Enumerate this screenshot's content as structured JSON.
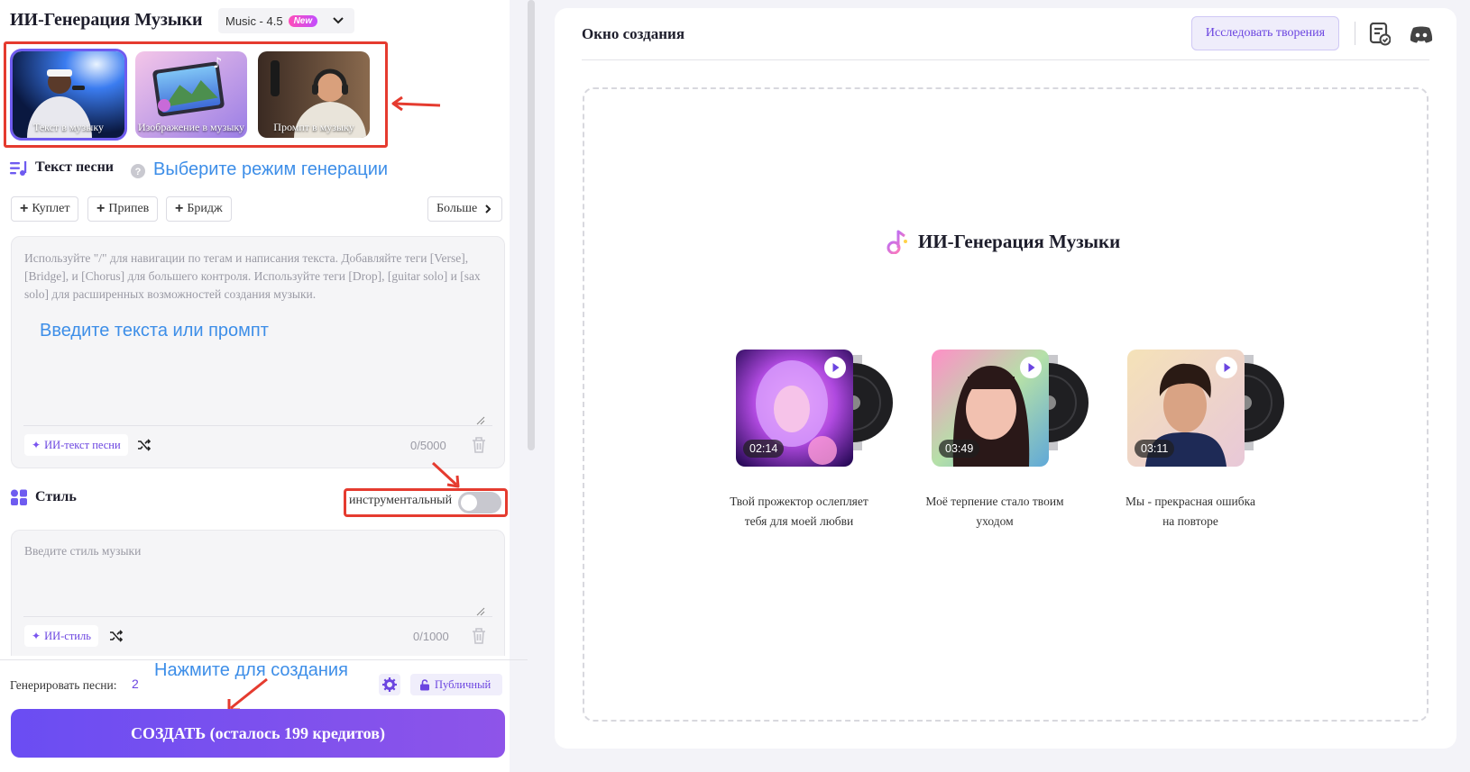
{
  "header": {
    "title": "ИИ-Генерация Музыки",
    "model_label": "Music - 4.5",
    "model_badge": "New"
  },
  "modes": [
    {
      "label": "Текст в музыку",
      "active": true
    },
    {
      "label": "Изображение в музыку",
      "active": false
    },
    {
      "label": "Промпт в музыку",
      "active": false
    }
  ],
  "annotations": {
    "mode_hint": "Выберите режим генерации",
    "lyrics_hint": "Введите текста или промпт",
    "create_hint": "Нажмите для создания"
  },
  "lyrics": {
    "title": "Текст песни",
    "tags": [
      "Куплет",
      "Припев",
      "Бридж"
    ],
    "more_label": "Больше",
    "placeholder": "Используйте \"/\" для навигации по тегам и написания текста. Добавляйте теги [Verse], [Bridge], и [Chorus] для большего контроля. Используйте теги [Drop], [guitar solo] и [sax solo] для расширенных возможностей создания музыки.",
    "ai_label": "ИИ-текст песни",
    "counter": "0/5000"
  },
  "style": {
    "title": "Стиль",
    "instrumental_label": "инструментальный",
    "instrumental_on": false,
    "placeholder": "Введите стиль музыки",
    "ai_label": "ИИ-стиль",
    "counter": "0/1000"
  },
  "footer": {
    "generate_label": "Генерировать песни:",
    "generate_count": "2",
    "public_label": "Публичный",
    "create_label": "СОЗДАТЬ (осталось 199 кредитов)"
  },
  "right": {
    "title": "Окно создания",
    "explore_label": "Исследовать творения",
    "center_title": "ИИ-Генерация Музыки",
    "songs": [
      {
        "duration": "02:14",
        "title": "Твой прожектор ослепляет тебя для моей любви"
      },
      {
        "duration": "03:49",
        "title": "Моё терпение стало твоим уходом"
      },
      {
        "duration": "03:11",
        "title": "Мы - прекрасная ошибка на повторе"
      }
    ]
  },
  "colors": {
    "accent": "#6b45e0",
    "annotation_red": "#e53b2f",
    "annotation_blue": "#3d8ee8"
  },
  "icons": {
    "lyrics": "lyrics-icon",
    "style": "style-icon",
    "help": "help-icon",
    "shuffle": "shuffle-icon",
    "trash": "trash-icon",
    "gear": "gear-icon",
    "lock": "lock-icon",
    "history": "history-icon",
    "discord": "discord-icon",
    "play": "play-icon",
    "music_note": "music-note-icon"
  }
}
